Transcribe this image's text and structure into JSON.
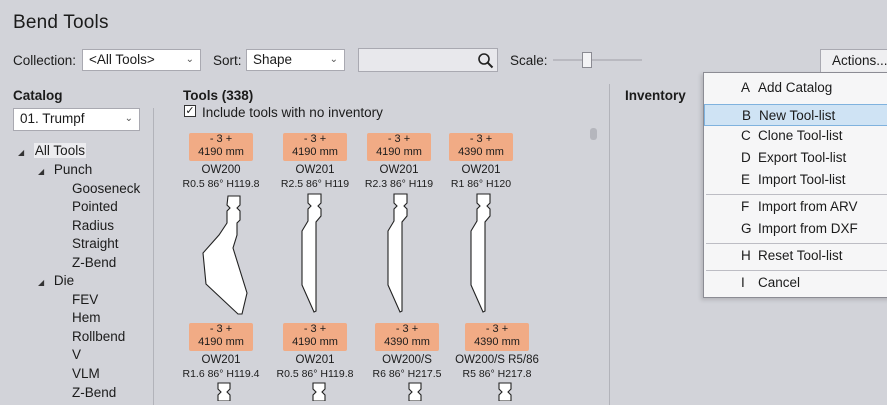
{
  "window": {
    "title": "Bend Tools"
  },
  "toolbar": {
    "collection_label": "Collection:",
    "collection_value": "<All Tools>",
    "sort_label": "Sort:",
    "sort_value": "Shape",
    "search_value": "",
    "scale_label": "Scale:",
    "scale_level": 0.5,
    "actions_label": "Actions..."
  },
  "catalog": {
    "heading": "Catalog",
    "selected": "01. Trumpf",
    "tree": [
      {
        "label": "All Tools",
        "level": 0,
        "expander": true
      },
      {
        "label": "Punch",
        "level": 1,
        "expander": true
      },
      {
        "label": "Gooseneck",
        "level": 2
      },
      {
        "label": "Pointed",
        "level": 2
      },
      {
        "label": "Radius",
        "level": 2
      },
      {
        "label": "Straight",
        "level": 2
      },
      {
        "label": "Z-Bend",
        "level": 2
      },
      {
        "label": "Die",
        "level": 1,
        "expander": true
      },
      {
        "label": "FEV",
        "level": 2
      },
      {
        "label": "Hem",
        "level": 2
      },
      {
        "label": "Rollbend",
        "level": 2
      },
      {
        "label": "V",
        "level": 2
      },
      {
        "label": "VLM",
        "level": 2
      },
      {
        "label": "Z-Bend",
        "level": 2
      }
    ]
  },
  "tools": {
    "heading": "Tools (338)",
    "include_label": "Include tools with no inventory",
    "include_checked": true,
    "cards": [
      {
        "badge_top": "- 3 +",
        "badge_bottom": "4190 mm",
        "name": "OW200",
        "desc": "R0.5  86°  H119.8",
        "shape": "gooseneck"
      },
      {
        "badge_top": "- 3 +",
        "badge_bottom": "4190 mm",
        "name": "OW201",
        "desc": "R2.5  86°  H119",
        "shape": "straight"
      },
      {
        "badge_top": "- 3 +",
        "badge_bottom": "4190 mm",
        "name": "OW201",
        "desc": "R2.3  86°  H119",
        "shape": "straight"
      },
      {
        "badge_top": "- 3 +",
        "badge_bottom": "4390 mm",
        "name": "OW201",
        "desc": "R1  86°  H120",
        "shape": "straight"
      },
      {
        "badge_top": "- 3 +",
        "badge_bottom": "4190 mm",
        "name": "OW201",
        "desc": "R1.6  86°  H119.4",
        "shape": "stub"
      },
      {
        "badge_top": "- 3 +",
        "badge_bottom": "4190 mm",
        "name": "OW201",
        "desc": "R0.5  86°  H119.8",
        "shape": "stub"
      },
      {
        "badge_top": "- 3 +",
        "badge_bottom": "4390 mm",
        "name": "OW200/S",
        "desc": "R6  86°  H217.5",
        "shape": "stub"
      },
      {
        "badge_top": "- 3 +",
        "badge_bottom": "4390 mm",
        "name": "OW200/S R5/86",
        "desc": "R5  86°  H217.8",
        "shape": "stub"
      }
    ]
  },
  "inventory": {
    "heading": "Inventory"
  },
  "actions_menu": {
    "items": [
      {
        "key": "A",
        "label": "Add Catalog"
      },
      {
        "key": "B",
        "label": "New Tool-list",
        "selected": true
      },
      {
        "key": "C",
        "label": "Clone Tool-list"
      },
      {
        "key": "D",
        "label": "Export Tool-list"
      },
      {
        "key": "E",
        "label": "Import Tool-list"
      },
      {
        "key": "F",
        "label": "Import from ARV"
      },
      {
        "key": "G",
        "label": "Import from DXF"
      },
      {
        "key": "H",
        "label": "Reset Tool-list"
      },
      {
        "key": "I",
        "label": "Cancel"
      }
    ]
  },
  "icons": {
    "search": "magnifier-icon",
    "dropdown": "chevron-down-icon",
    "expander": "triangle-expanded-icon",
    "checkbox": "checkmark-icon"
  },
  "colors": {
    "background": "#d2d3d9",
    "badge": "#f1ab85",
    "menu_selection": "#cfe3f4",
    "menu_selection_border": "#7fb2de"
  }
}
